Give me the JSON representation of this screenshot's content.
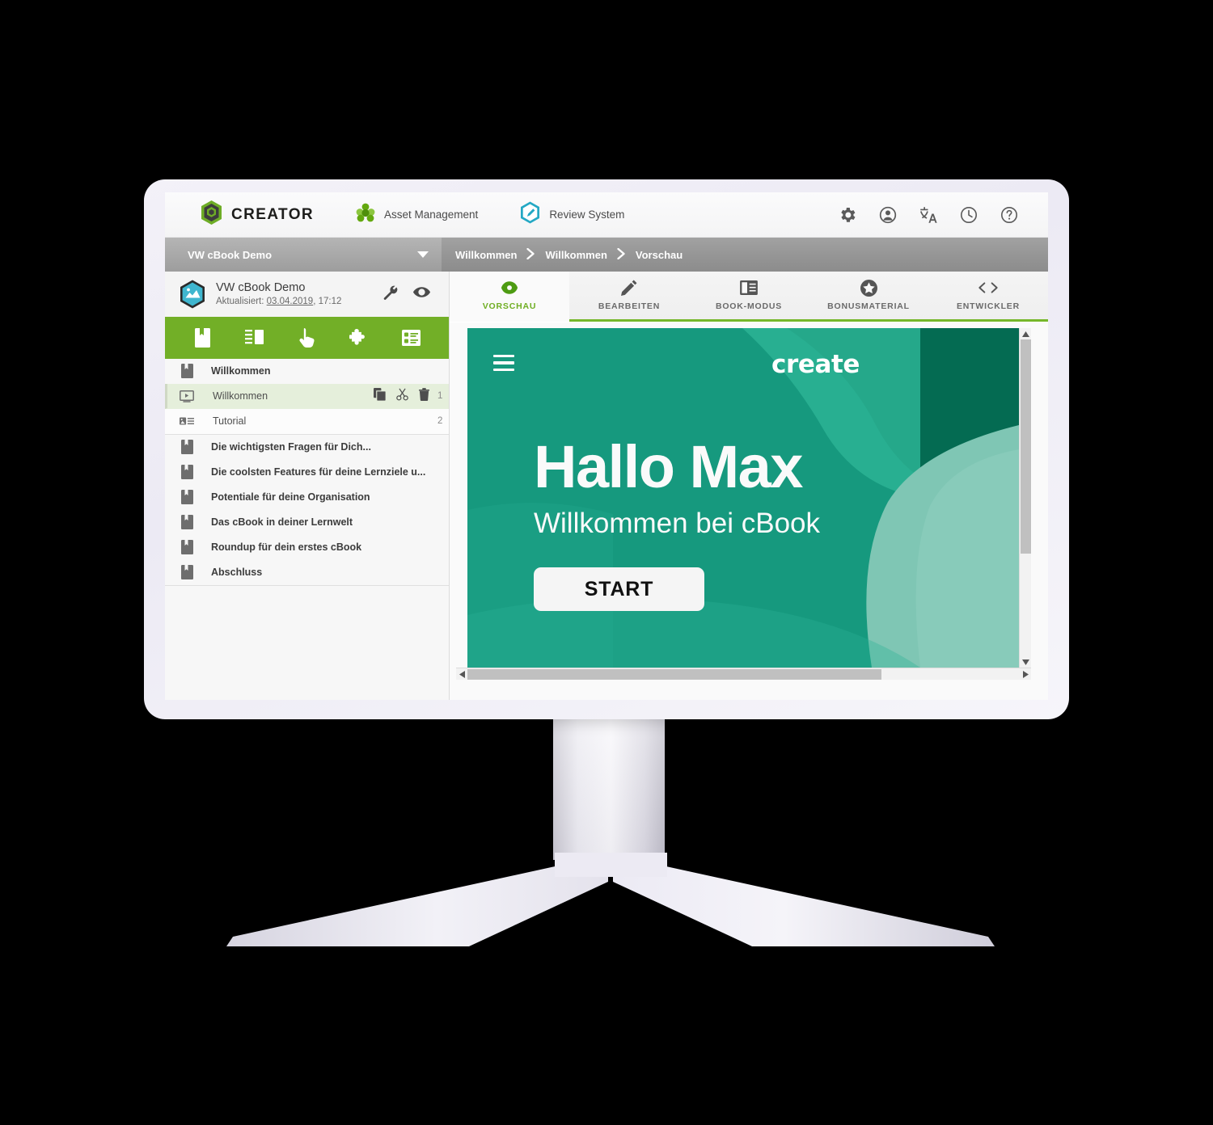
{
  "header": {
    "brand": "CREATOR",
    "brand_icon": "hexagon-creator-logo",
    "apps": [
      {
        "label": "Asset Management",
        "icon": "asset-management-icon"
      },
      {
        "label": "Review System",
        "icon": "review-system-icon"
      }
    ],
    "icons": [
      {
        "name": "gear-icon"
      },
      {
        "name": "account-icon"
      },
      {
        "name": "translate-icon"
      },
      {
        "name": "history-clock-icon"
      },
      {
        "name": "help-icon"
      }
    ]
  },
  "subbar": {
    "project_selected": "VW cBook Demo",
    "breadcrumb": [
      "Willkommen",
      "Willkommen",
      "Vorschau"
    ],
    "separator": "›"
  },
  "sidebar": {
    "project": {
      "title": "VW cBook Demo",
      "updated_prefix": "Aktualisiert:",
      "updated_date": "03.04.2019",
      "updated_time": ", 17:12",
      "thumb_icon": "project-thumbnail-icon",
      "actions": [
        {
          "name": "wrench-icon"
        },
        {
          "name": "eye-icon"
        }
      ]
    },
    "toolbar": [
      {
        "name": "new-chapter-icon"
      },
      {
        "name": "layout-icon"
      },
      {
        "name": "interaction-icon"
      },
      {
        "name": "puzzle-icon"
      },
      {
        "name": "quiz-icon"
      }
    ],
    "tree": [
      {
        "type": "chapter",
        "label": "Willkommen",
        "icon": "chapter-icon",
        "selected": false
      },
      {
        "type": "page",
        "label": "Willkommen",
        "icon": "video-page-icon",
        "selected": true,
        "number": "1",
        "tools": [
          {
            "name": "copy-icon"
          },
          {
            "name": "cut-icon"
          },
          {
            "name": "delete-icon"
          }
        ]
      },
      {
        "type": "page",
        "label": "Tutorial",
        "icon": "media-text-page-icon",
        "selected": false,
        "number": "2",
        "tools": []
      },
      {
        "type": "chapter",
        "label": "Die wichtigsten Fragen für Dich...",
        "icon": "chapter-icon",
        "selected": false
      },
      {
        "type": "chapter",
        "label": "Die coolsten Features für deine Lernziele u...",
        "icon": "chapter-icon",
        "selected": false
      },
      {
        "type": "chapter",
        "label": "Potentiale für deine Organisation",
        "icon": "chapter-icon",
        "selected": false
      },
      {
        "type": "chapter",
        "label": "Das cBook in deiner Lernwelt",
        "icon": "chapter-icon",
        "selected": false
      },
      {
        "type": "chapter",
        "label": "Roundup für dein erstes cBook",
        "icon": "chapter-icon",
        "selected": false
      },
      {
        "type": "chapter",
        "label": "Abschluss",
        "icon": "chapter-icon",
        "selected": false
      }
    ]
  },
  "tabs": [
    {
      "label": "VORSCHAU",
      "icon": "eye-icon",
      "active": true
    },
    {
      "label": "BEARBEITEN",
      "icon": "pencil-icon",
      "active": false
    },
    {
      "label": "BOOK-MODUS",
      "icon": "book-mode-icon",
      "active": false
    },
    {
      "label": "BONUSMATERIAL",
      "icon": "star-icon",
      "active": false
    },
    {
      "label": "ENTWICKLER",
      "icon": "code-icon",
      "active": false
    }
  ],
  "preview": {
    "menu_icon": "hamburger-menu-icon",
    "logo": "create",
    "heading": "Hallo Max",
    "subheading": "Willkommen bei cBook",
    "start_button": "START",
    "scrollbars": {
      "vertical_up": "▲",
      "vertical_down": "▼",
      "horizontal_left": "◄",
      "horizontal_right": "►"
    }
  },
  "colors": {
    "brand_green": "#72af27",
    "tab_accent": "#76b72a",
    "slide_teal": "#16997e",
    "slide_dark_green": "#046b52",
    "slide_mint": "#7fc6b4",
    "slide_light_teal": "#2bb394"
  }
}
